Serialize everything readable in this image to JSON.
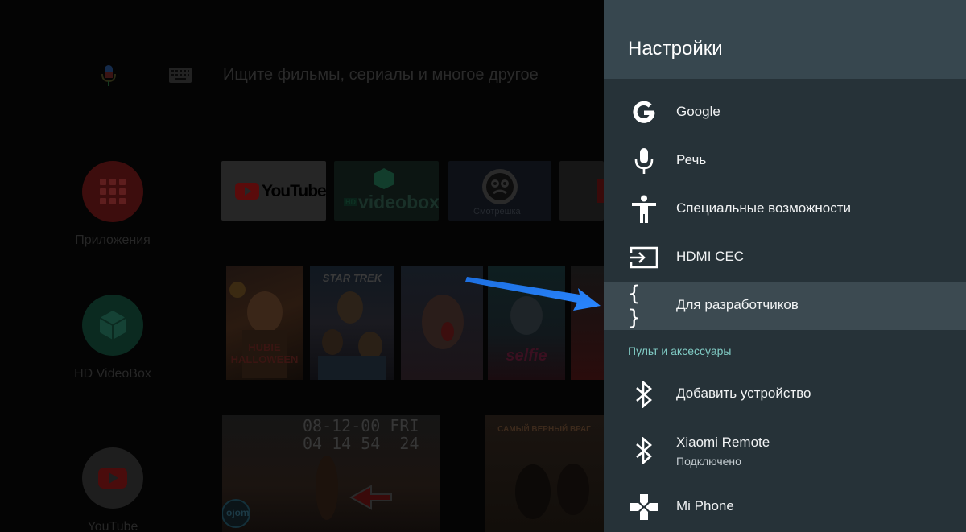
{
  "search": {
    "placeholder": "Ищите фильмы, сериалы и многое другое"
  },
  "home": {
    "side_apps": [
      {
        "label": "Приложения"
      },
      {
        "label": "HD VideoBox"
      },
      {
        "label": "YouTube"
      }
    ],
    "tiles": [
      {
        "label": "YouTube"
      },
      {
        "prefix": "HD",
        "label": "videobox"
      },
      {
        "label": "Смотрешка"
      }
    ],
    "posters": [
      {
        "title": "HUBIE HALLOWEEN"
      },
      {
        "title": "STAR TREK"
      },
      {
        "title": ""
      },
      {
        "title": "selfie"
      },
      {
        "title": ""
      }
    ],
    "thumbs": [
      {
        "overlay": "08-12-00 FRI\n04 14 54  24",
        "logo": "ojom"
      },
      {
        "caption": "САМЫЙ ВЕРНЫЙ ВРАГ"
      }
    ]
  },
  "panel": {
    "title": "Настройки",
    "items": [
      {
        "icon": "google-g-icon",
        "label": "Google"
      },
      {
        "icon": "mic-icon",
        "label": "Речь"
      },
      {
        "icon": "accessibility-icon",
        "label": "Специальные возможности"
      },
      {
        "icon": "hdmi-input-icon",
        "label": "HDMI CEC"
      },
      {
        "icon": "braces-icon",
        "label": "Для разработчиков",
        "glyph": "{ }",
        "focused": true
      }
    ],
    "section_label": "Пульт и аксессуары",
    "accessories": [
      {
        "icon": "bluetooth-icon",
        "label": "Добавить устройство"
      },
      {
        "icon": "bluetooth-icon",
        "label": "Xiaomi Remote",
        "status": "Подключено"
      },
      {
        "icon": "gamepad-icon",
        "label": "Mi Phone"
      }
    ]
  },
  "colors": {
    "panel_bg": "#263238",
    "panel_header": "#37474f",
    "focused_row": "#3c4a51",
    "section_accent": "#80cbc4",
    "arrow": "#1e7cf2"
  }
}
